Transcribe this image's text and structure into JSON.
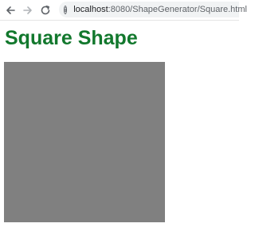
{
  "browser": {
    "url_host": "localhost",
    "url_path": ":8080/ShapeGenerator/Square.html",
    "info_icon_glyph": "i"
  },
  "page": {
    "title": "Square Shape",
    "title_color": "#12782d"
  },
  "shape": {
    "type": "square",
    "fill_color": "#808080"
  }
}
